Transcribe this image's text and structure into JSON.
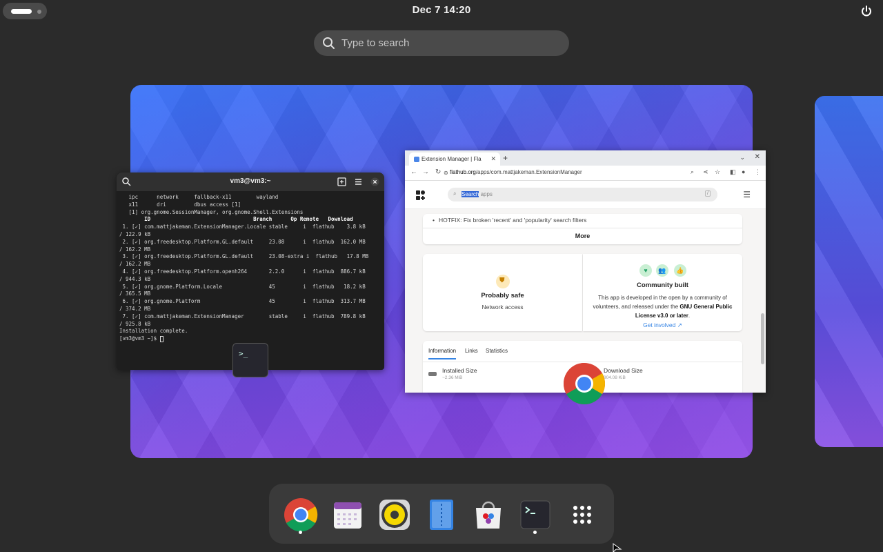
{
  "topbar": {
    "clock": "Dec 7  14:20"
  },
  "search": {
    "placeholder": "Type to search"
  },
  "terminal": {
    "title": "vm3@vm3:~",
    "lines": [
      "   ipc      network     fallback-x11        wayland",
      "   x11      dri         dbus access [1]",
      "",
      "   [1] org.gnome.SessionManager, org.gnome.Shell.Extensions",
      "",
      "",
      "        ID                                 Branch      Op Remote   Download",
      " 1. [✓] com.mattjakeman.ExtensionManager.Locale stable     i  flathub    3.8 kB",
      "/ 122.9 kB",
      " 2. [✓] org.freedesktop.Platform.GL.default     23.08      i  flathub  162.0 MB",
      "/ 162.2 MB",
      " 3. [✓] org.freedesktop.Platform.GL.default     23.08-extra i  flathub   17.8 MB",
      "/ 162.2 MB",
      " 4. [✓] org.freedesktop.Platform.openh264       2.2.0      i  flathub  886.7 kB",
      "/ 944.3 kB",
      " 5. [✓] org.gnome.Platform.Locale               45         i  flathub   18.2 kB",
      "/ 365.5 MB",
      " 6. [✓] org.gnome.Platform                      45         i  flathub  313.7 MB",
      "/ 374.2 MB",
      " 7. [✓] com.mattjakeman.ExtensionManager        stable     i  flathub  789.8 kB",
      "/ 925.8 kB",
      "",
      "Installation complete.",
      "[vm3@vm3 ~]$ "
    ],
    "badge": ">_"
  },
  "browser": {
    "tab_title": "Extension Manager | Fla",
    "url_domain": "flathub.org",
    "url_path": "/apps/com.mattjakeman.ExtensionManager",
    "search_placeholder_selected": "Search",
    "search_placeholder_rest": " apps",
    "search_shortcut": "/",
    "hotfix": "HOTFIX: Fix broken 'recent' and 'popularity' search filters",
    "more": "More",
    "safe_title": "Probably safe",
    "safe_sub": "Network access",
    "community_title": "Community built",
    "community_text_1": "This app is developed in the open by a community of volunteers, and released under the ",
    "community_text_bold": "GNU General Public License v3.0 or later",
    "community_text_2": ".",
    "get_involved": "Get involved ↗",
    "tabs": [
      "Information",
      "Links",
      "Statistics"
    ],
    "installed_size_label": "Installed Size",
    "installed_size_value": "~2.36 MiB",
    "download_size_label": "Download Size",
    "download_size_value": "804.08 KiB"
  },
  "dock": {
    "apps": [
      "chrome-icon",
      "calendar-icon",
      "rhythmbox-icon",
      "files-icon",
      "software-icon",
      "terminal-icon",
      "app-grid-icon"
    ],
    "running": [
      "chrome-icon",
      "terminal-icon"
    ]
  },
  "colors": {
    "accent": "#3584e4",
    "panel": "#2b2b2b",
    "dock": "#3a3a3a"
  }
}
